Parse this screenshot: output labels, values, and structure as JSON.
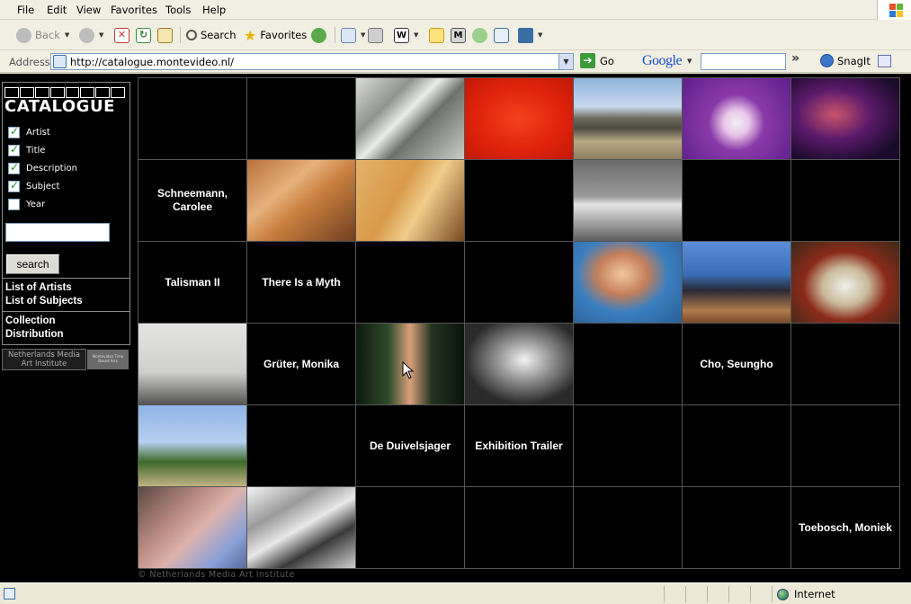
{
  "menu": [
    "File",
    "Edit",
    "View",
    "Favorites",
    "Tools",
    "Help"
  ],
  "toolbar": {
    "back": "Back",
    "search": "Search",
    "favorites": "Favorites"
  },
  "address": {
    "label": "Address",
    "url": "http://catalogue.montevideo.nl/",
    "go": "Go"
  },
  "google": {
    "logo": "Google",
    "search_value": ""
  },
  "snagit": "SnagIt",
  "sidebar": {
    "logo_text": "CATALOGUE",
    "checkboxes": [
      {
        "label": "Artist",
        "checked": true
      },
      {
        "label": "Title",
        "checked": true
      },
      {
        "label": "Description",
        "checked": true
      },
      {
        "label": "Subject",
        "checked": true
      },
      {
        "label": "Year",
        "checked": false
      }
    ],
    "search_value": "",
    "search_button": "search",
    "links_1": [
      "List of Artists",
      "List of Subjects"
    ],
    "links_2": [
      "Collection",
      "Distribution"
    ],
    "institute_logo": "Netherlands Media Art Institute",
    "institute_logo_2": "Montevideo Time Based Arts"
  },
  "grid": [
    [
      "",
      "",
      "img:boat",
      "img:red",
      "img:mountains",
      "img:purple",
      "img:dancer"
    ],
    [
      "Schneemann, Carolee",
      "img:hands",
      "img:phone",
      "",
      "img:car",
      "",
      ""
    ],
    [
      "Talisman II",
      "There Is a Myth",
      "",
      "",
      "img:woman",
      "img:anchor",
      "img:mask"
    ],
    [
      "img:map",
      "Grüter, Monika",
      "img:bars",
      "img:bw-man",
      "",
      "Cho, Seungho",
      ""
    ],
    [
      "img:crane",
      "",
      "De Duivelsjager",
      "Exhibition Trailer",
      "",
      "",
      ""
    ],
    [
      "img:skin",
      "img:wood",
      "",
      "",
      "",
      "",
      "Toebosch, Moniek"
    ]
  ],
  "copyright": "© Netherlands Media Art Institute",
  "status": {
    "zone": "Internet"
  }
}
